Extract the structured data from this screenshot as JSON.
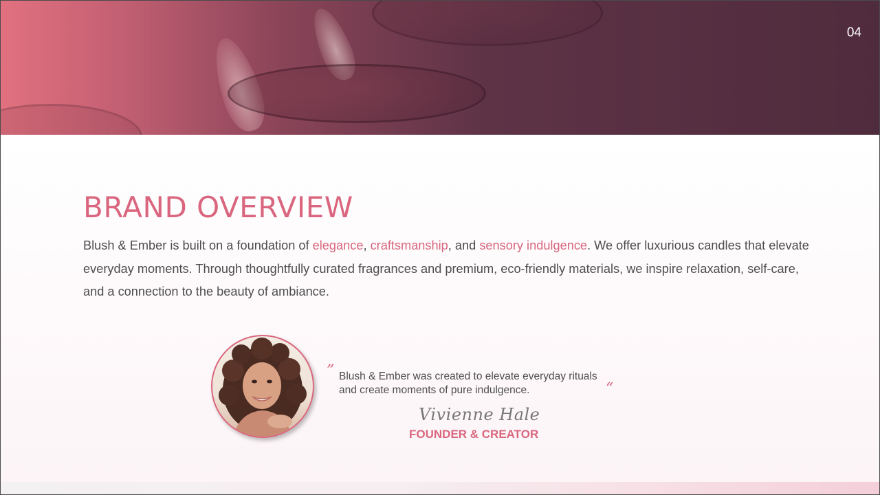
{
  "slide": {
    "page_number": "04"
  },
  "hero": {
    "description_colors": {
      "left": "#e1717f",
      "right": "#4f2c3d"
    }
  },
  "overview": {
    "title": "BRAND OVERVIEW",
    "paragraph": {
      "part1": "Blush & Ember is built on a foundation of ",
      "highlight1": "elegance",
      "sep1": ", ",
      "highlight2": "craftsmanship",
      "sep2": ", and ",
      "highlight3": "sensory indulgence",
      "part2": ". We offer luxurious candles that elevate everyday moments. Through thoughtfully curated fragrances and premium, eco-friendly materials, we inspire relaxation, self-care, and a connection to the beauty of ambiance."
    }
  },
  "testimonial": {
    "open_mark": "”",
    "close_mark": "“",
    "quote": "Blush & Ember was created to elevate everyday rituals and create moments of pure indulgence.",
    "name": "Vivienne Hale",
    "role": "FOUNDER & CREATOR"
  },
  "colors": {
    "accent": "#d9667e",
    "body_text": "#4d4d4d"
  }
}
